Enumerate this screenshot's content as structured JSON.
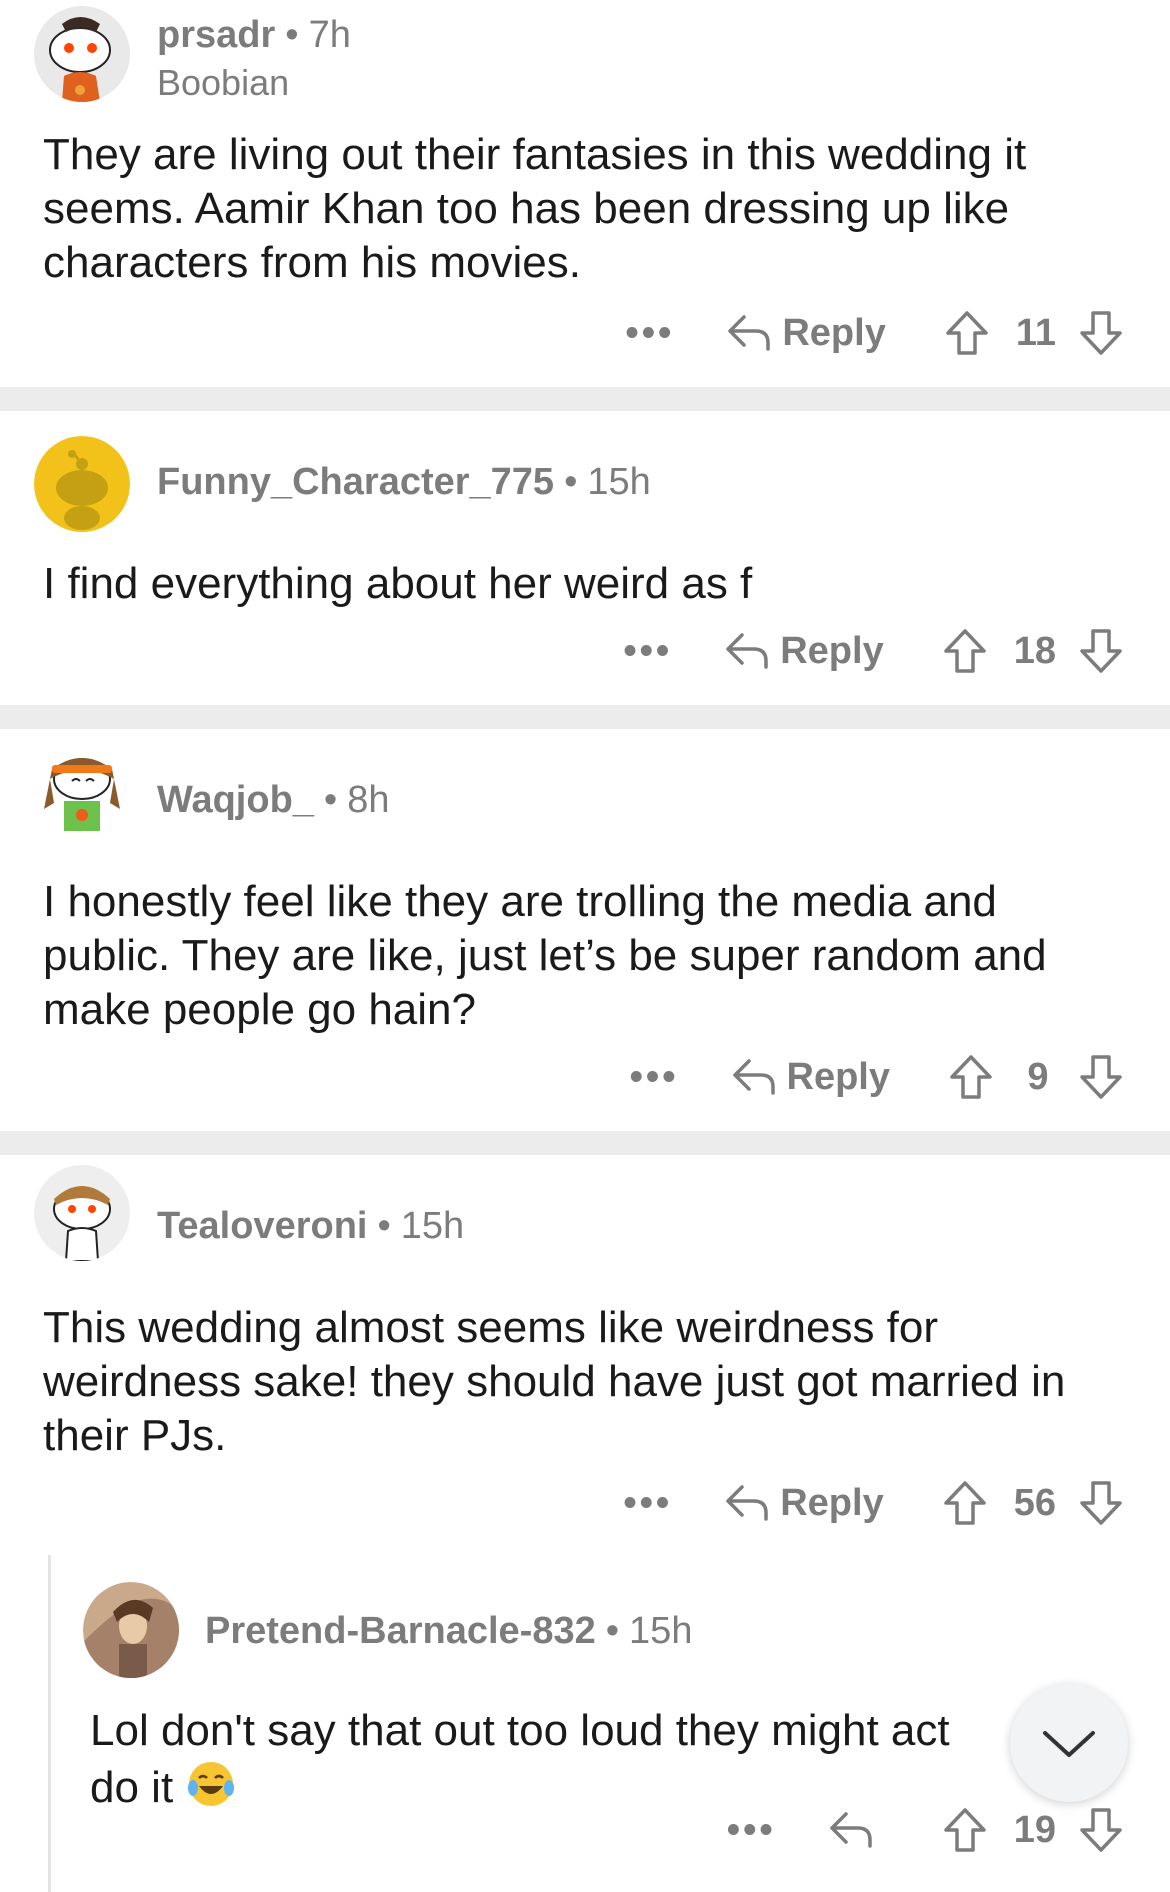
{
  "comments": [
    {
      "username": "prsadr",
      "time": "7h",
      "flair": "Boobian",
      "text": "They are living out their fantasies in this wedding it seems. Aamir Khan too has been dressing up like characters from his movies.",
      "reply_label": "Reply",
      "votes": "11",
      "avatar_icon": "snoo-avatar-orange-hat-icon"
    },
    {
      "username": "Funny_Character_775",
      "time": "15h",
      "text": "I find everything about her weird as f",
      "reply_label": "Reply",
      "votes": "18",
      "avatar_icon": "snoo-avatar-yellow-icon"
    },
    {
      "username": "Waqjob_",
      "time": "8h",
      "text": "I honestly feel like they are trolling the media and public. They are like, just let’s be super random and make people go hain?",
      "reply_label": "Reply",
      "votes": "9",
      "avatar_icon": "snoo-avatar-headband-icon"
    },
    {
      "username": "Tealoveroni",
      "time": "15h",
      "text": "This wedding almost seems like weirdness for weirdness sake! they should have just got married in their PJs.",
      "reply_label": "Reply",
      "votes": "56",
      "avatar_icon": "snoo-avatar-brown-hair-icon"
    },
    {
      "username": "Pretend-Barnacle-832",
      "time": "15h",
      "text": "Lol don't say that out too loud they might act do it",
      "emoji": "😂",
      "votes": "19",
      "avatar_icon": "photo-avatar-icon"
    }
  ],
  "more_label": "•••",
  "separator": "•",
  "colors": {
    "meta_gray": "#7c7c7c",
    "divider": "#ececed",
    "text": "#1a1a1b"
  }
}
